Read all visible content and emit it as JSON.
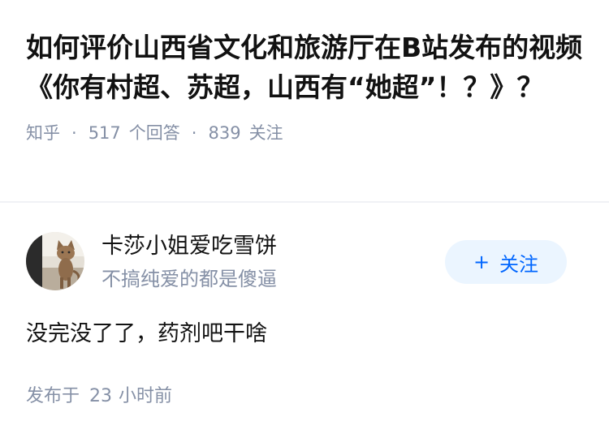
{
  "question": {
    "title": "如何评价山西省文化和旅游厅在B站发布的视频《你有村超、苏超，山西有“她超”！？》？",
    "source": "知乎",
    "separator": "·",
    "answer_count": "517",
    "answer_count_label": "个回答",
    "follower_count": "839",
    "follower_label": "关注"
  },
  "answer": {
    "author_name": "卡莎小姐爱吃雪饼",
    "author_bio": "不搞纯爱的都是傻逼",
    "follow_button": {
      "plus": "+",
      "label": "关注"
    },
    "content": "没完没了了，药剂吧干啥",
    "time_prefix": "发布于",
    "time_value": "23",
    "time_unit": "小时前"
  },
  "colors": {
    "primary": "#0066ff",
    "follow_bg": "#ebf5ff",
    "meta_gray": "#8590a6",
    "text": "#121212"
  },
  "icons": {
    "avatar": "cat-avatar"
  }
}
